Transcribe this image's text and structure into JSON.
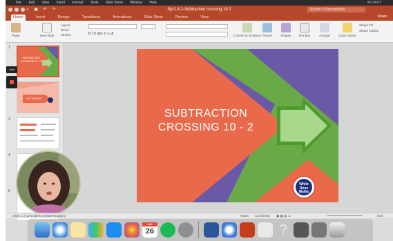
{
  "menubar": {
    "items": [
      "",
      "File",
      "Edit",
      "View",
      "Insert",
      "Format",
      "Tools",
      "Slide Show",
      "Window",
      "Help"
    ],
    "right": "Fri 14:07"
  },
  "window": {
    "title": "Spr1.4.2-Subtraction crossing 10 2",
    "search_placeholder": "Search in Presentation"
  },
  "ribbon": {
    "tabs": [
      "Home",
      "Insert",
      "Design",
      "Transitions",
      "Animations",
      "Slide Show",
      "Review",
      "View"
    ],
    "active_tab": "Home",
    "share_label": "Share",
    "groups": [
      "Paste",
      "New Slide",
      "Layout",
      "Reset",
      "Section",
      "Convert to SmartArt",
      "Picture",
      "Shapes",
      "Text Box",
      "Arrange",
      "Quick Styles",
      "Shape Fill",
      "Shape Outline"
    ]
  },
  "side_panel": {
    "record_label": "Cam"
  },
  "slides": {
    "thumbnails": [
      {
        "num": "1",
        "text": "SUBTRACTION CROSSING 10 - 2"
      },
      {
        "num": "",
        "text": "GET READY"
      },
      {
        "num": "3",
        "text": ""
      },
      {
        "num": "4",
        "text": ""
      },
      {
        "num": "5",
        "text": ""
      }
    ]
  },
  "slide": {
    "title_line1": "SUBTRACTION",
    "title_line2": "CROSSING 10 - 2",
    "logo_text": "White Rose Maths"
  },
  "statusbar": {
    "slide_info": "Slide 1 of 12",
    "language": "English (United Kingdom)",
    "notes_label": "Notes",
    "comments_label": "Comments",
    "zoom": "83%"
  },
  "dock": {
    "calendar_month": "JUL",
    "calendar_day": "26"
  },
  "colors": {
    "ribbon": "#b7472a",
    "slide_red": "#e96a4b",
    "slide_green": "#6aaa46",
    "slide_purple": "#6b59a7",
    "arrow_green": "#a9d88c"
  }
}
